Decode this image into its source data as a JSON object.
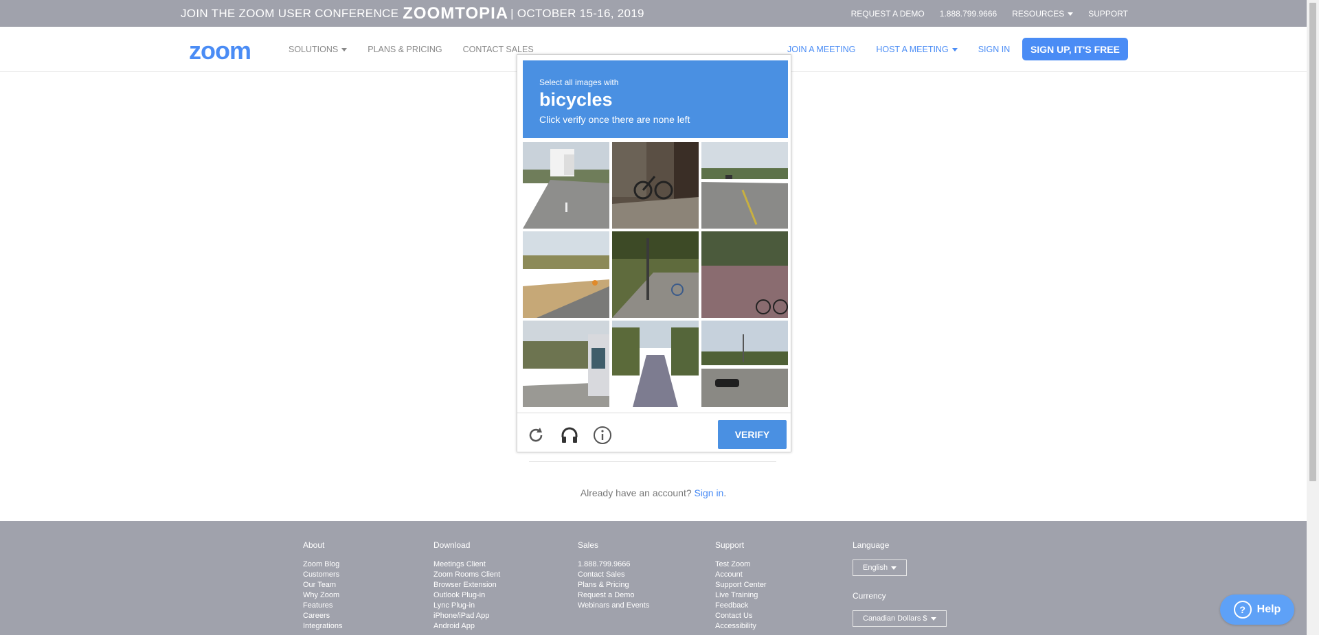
{
  "banner": {
    "left_prefix": "JOIN THE ZOOM USER CONFERENCE",
    "logo_text": "ZOOMTOPIA",
    "left_suffix": "| OCTOBER 15-16, 2019",
    "links": [
      "REQUEST A DEMO",
      "1.888.799.9666",
      "RESOURCES",
      "SUPPORT"
    ]
  },
  "nav": {
    "logo": "zoom",
    "left": [
      "SOLUTIONS",
      "PLANS & PRICING",
      "CONTACT SALES"
    ],
    "right": [
      "JOIN A MEETING",
      "HOST A MEETING",
      "SIGN IN"
    ],
    "signup": "SIGN UP, IT'S FREE"
  },
  "page": {
    "already_text": "Already have an account?",
    "signin_link": "Sign in",
    "period": "."
  },
  "captcha": {
    "instruction_small": "Select all images with",
    "target": "bicycles",
    "instruction_sub": "Click verify once there are none left",
    "verify": "VERIFY",
    "icons": [
      "reload-icon",
      "headphones-icon",
      "info-icon"
    ]
  },
  "footer": {
    "columns": [
      {
        "title": "About",
        "items": [
          "Zoom Blog",
          "Customers",
          "Our Team",
          "Why Zoom",
          "Features",
          "Careers",
          "Integrations"
        ]
      },
      {
        "title": "Download",
        "items": [
          "Meetings Client",
          "Zoom Rooms Client",
          "Browser Extension",
          "Outlook Plug-in",
          "Lync Plug-in",
          "iPhone/iPad App",
          "Android App"
        ]
      },
      {
        "title": "Sales",
        "items": [
          "1.888.799.9666",
          "Contact Sales",
          "Plans & Pricing",
          "Request a Demo",
          "Webinars and Events"
        ]
      },
      {
        "title": "Support",
        "items": [
          "Test Zoom",
          "Account",
          "Support Center",
          "Live Training",
          "Feedback",
          "Contact Us",
          "Accessibility"
        ]
      }
    ],
    "language_label": "Language",
    "language_value": "English",
    "currency_label": "Currency",
    "currency_value": "Canadian Dollars $"
  },
  "help": {
    "label": "Help"
  },
  "colors": {
    "banner": "#a0a2ac",
    "brand_blue": "#4a8cf5",
    "captcha_blue": "#4a90e2"
  }
}
